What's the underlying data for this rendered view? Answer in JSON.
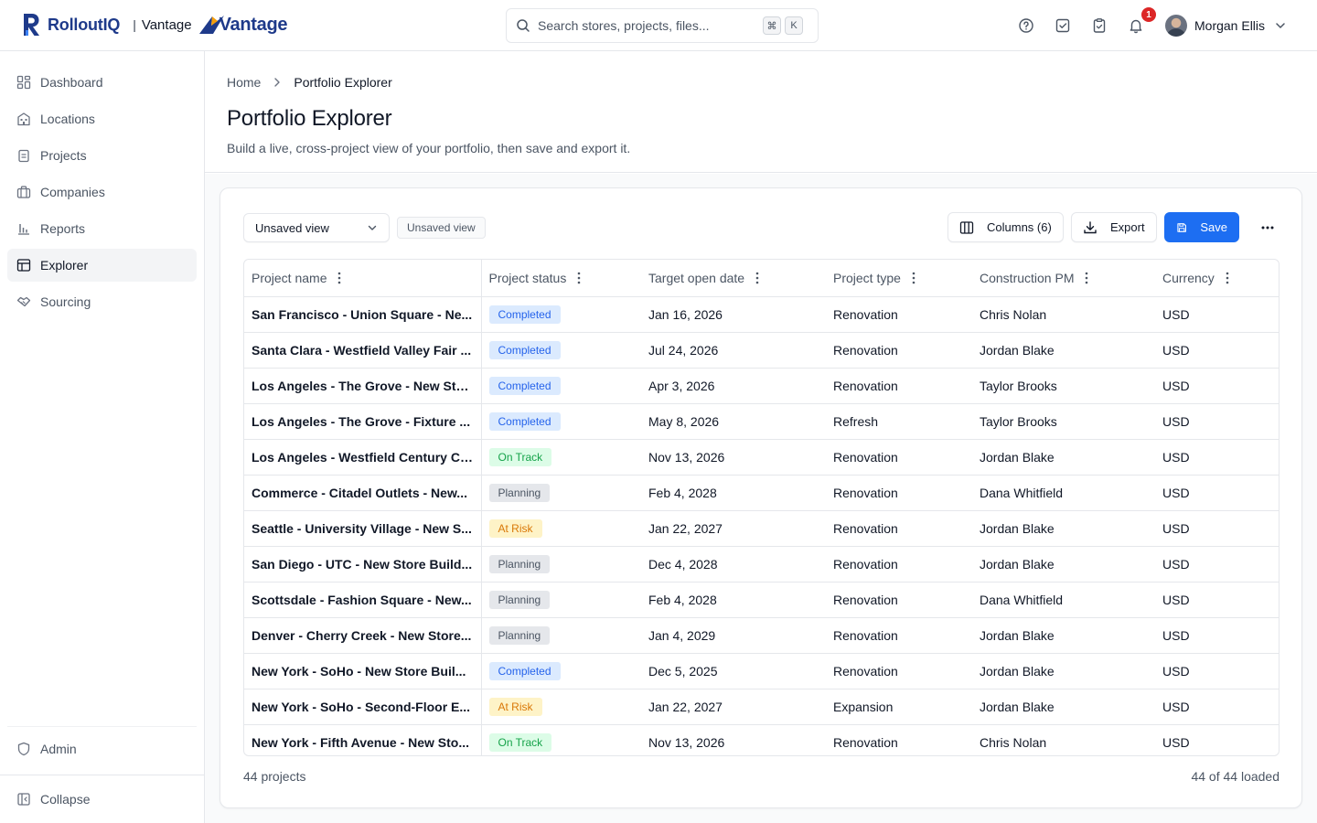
{
  "brand": {
    "name": "RolloutIQ",
    "separator": "|",
    "client": "Vantage",
    "client_logo_word": "Vantage",
    "colors": {
      "primary": "#1e3a8a",
      "accent": "#1d6ef2"
    }
  },
  "search": {
    "placeholder": "Search stores, projects, files...",
    "shortcut_1": "⌘",
    "shortcut_2": "K"
  },
  "header_icons": [
    "help-icon",
    "task-check-icon",
    "clipboard-icon",
    "bell-icon"
  ],
  "notifications": {
    "count": "1"
  },
  "user": {
    "name": "Morgan Ellis"
  },
  "sidebar": {
    "items": [
      {
        "label": "Dashboard",
        "icon": "dashboard-icon"
      },
      {
        "label": "Locations",
        "icon": "building-icon"
      },
      {
        "label": "Projects",
        "icon": "clipboard-icon"
      },
      {
        "label": "Companies",
        "icon": "briefcase-icon"
      },
      {
        "label": "Reports",
        "icon": "bar-chart-icon"
      },
      {
        "label": "Explorer",
        "icon": "table-icon",
        "active": true
      },
      {
        "label": "Sourcing",
        "icon": "handshake-icon"
      }
    ],
    "admin_label": "Admin",
    "collapse_label": "Collapse"
  },
  "breadcrumb": {
    "home": "Home",
    "current": "Portfolio Explorer"
  },
  "page": {
    "title": "Portfolio Explorer",
    "subtitle": "Build a live, cross-project view of your portfolio, then save and export it."
  },
  "toolbar": {
    "view_select": "Unsaved view",
    "view_chip": "Unsaved view",
    "columns_label": "Columns (6)",
    "export_label": "Export",
    "save_label": "Save"
  },
  "table": {
    "columns": [
      "Project name",
      "Project status",
      "Target open date",
      "Project type",
      "Construction PM",
      "Currency"
    ],
    "rows": [
      {
        "name": "San Francisco - Union Square - Ne...",
        "status": "Completed",
        "status_kind": "completed",
        "date": "Jan 16, 2026",
        "type": "Renovation",
        "pm": "Chris Nolan",
        "currency": "USD"
      },
      {
        "name": "Santa Clara - Westfield Valley Fair ...",
        "status": "Completed",
        "status_kind": "completed",
        "date": "Jul 24, 2026",
        "type": "Renovation",
        "pm": "Jordan Blake",
        "currency": "USD"
      },
      {
        "name": "Los Angeles - The Grove - New Sto...",
        "status": "Completed",
        "status_kind": "completed",
        "date": "Apr 3, 2026",
        "type": "Renovation",
        "pm": "Taylor Brooks",
        "currency": "USD"
      },
      {
        "name": "Los Angeles - The Grove - Fixture ...",
        "status": "Completed",
        "status_kind": "completed",
        "date": "May 8, 2026",
        "type": "Refresh",
        "pm": "Taylor Brooks",
        "currency": "USD"
      },
      {
        "name": "Los Angeles - Westfield Century Ci...",
        "status": "On Track",
        "status_kind": "ontrack",
        "date": "Nov 13, 2026",
        "type": "Renovation",
        "pm": "Jordan Blake",
        "currency": "USD"
      },
      {
        "name": "Commerce - Citadel Outlets - New...",
        "status": "Planning",
        "status_kind": "planning",
        "date": "Feb 4, 2028",
        "type": "Renovation",
        "pm": "Dana Whitfield",
        "currency": "USD"
      },
      {
        "name": "Seattle - University Village - New S...",
        "status": "At Risk",
        "status_kind": "atrisk",
        "date": "Jan 22, 2027",
        "type": "Renovation",
        "pm": "Jordan Blake",
        "currency": "USD"
      },
      {
        "name": "San Diego - UTC - New Store Build...",
        "status": "Planning",
        "status_kind": "planning",
        "date": "Dec 4, 2028",
        "type": "Renovation",
        "pm": "Jordan Blake",
        "currency": "USD"
      },
      {
        "name": "Scottsdale - Fashion Square - New...",
        "status": "Planning",
        "status_kind": "planning",
        "date": "Feb 4, 2028",
        "type": "Renovation",
        "pm": "Dana Whitfield",
        "currency": "USD"
      },
      {
        "name": "Denver - Cherry Creek - New Store...",
        "status": "Planning",
        "status_kind": "planning",
        "date": "Jan 4, 2029",
        "type": "Renovation",
        "pm": "Jordan Blake",
        "currency": "USD"
      },
      {
        "name": "New York - SoHo - New Store Buil...",
        "status": "Completed",
        "status_kind": "completed",
        "date": "Dec 5, 2025",
        "type": "Renovation",
        "pm": "Jordan Blake",
        "currency": "USD"
      },
      {
        "name": "New York - SoHo - Second-Floor E...",
        "status": "At Risk",
        "status_kind": "atrisk",
        "date": "Jan 22, 2027",
        "type": "Expansion",
        "pm": "Jordan Blake",
        "currency": "USD"
      },
      {
        "name": "New York - Fifth Avenue - New Sto...",
        "status": "On Track",
        "status_kind": "ontrack",
        "date": "Nov 13, 2026",
        "type": "Renovation",
        "pm": "Chris Nolan",
        "currency": "USD"
      }
    ]
  },
  "footer": {
    "count": "44 projects",
    "loaded": "44 of 44 loaded"
  }
}
